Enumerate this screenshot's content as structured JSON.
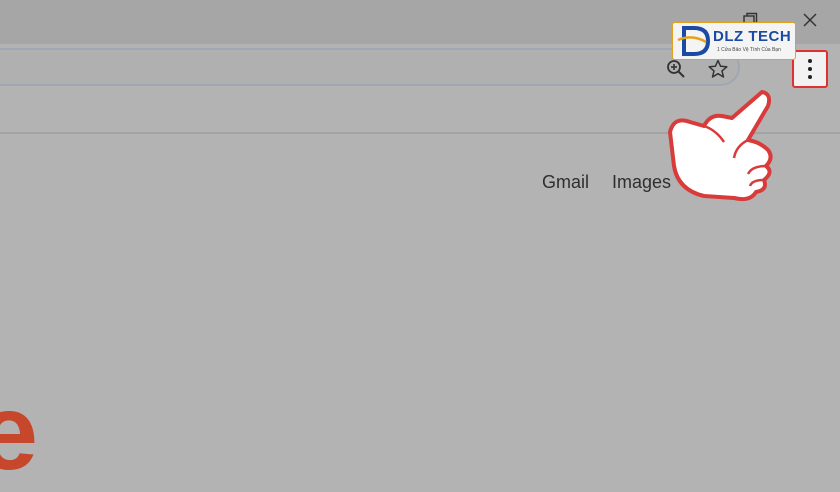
{
  "colors": {
    "page_bg": "#b3b3b3",
    "titlebar_bg": "#a6a6a6",
    "highlight": "#e03030",
    "logo_accent": "#c7472c",
    "brand_blue": "#1b4aa3"
  },
  "window_controls": {
    "minimize_icon": "minimize-icon",
    "restore_icon": "restore-icon",
    "close_icon": "close-icon"
  },
  "omnibox": {
    "zoom_icon": "zoom-in-icon",
    "bookmark_icon": "star-icon"
  },
  "menu": {
    "icon": "vertical-dots-icon"
  },
  "topnav": {
    "gmail": "Gmail",
    "images": "Images",
    "apps_icon": "apps-grid-icon"
  },
  "logo_partial": "e",
  "watermark": {
    "name": "DLZ TECH",
    "tagline": "1 Cửa Bảo Vệ Tính Của Bạn"
  }
}
